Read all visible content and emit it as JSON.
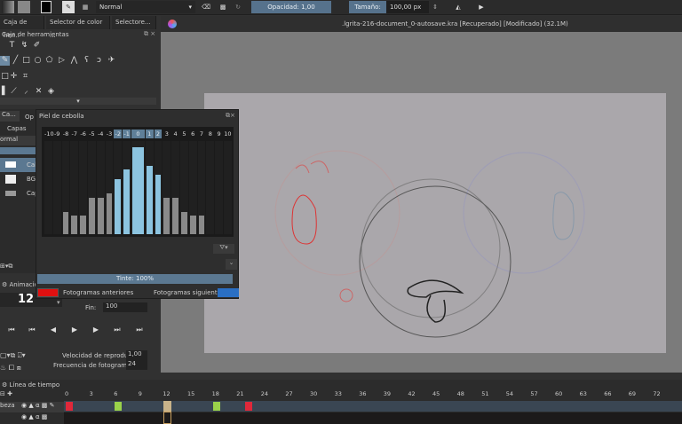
{
  "toolbar": {
    "blend_mode": "Normal",
    "opacity_label": "Opacidad:",
    "opacity_value": "1,00",
    "size_label": "Tamaño:",
    "size_value": "100,00 px"
  },
  "left_tabs": [
    "Caja de her...",
    "Selector de color ...",
    "Selectore..."
  ],
  "toolbox": {
    "title": "Caja de herramientas"
  },
  "document": {
    "title": ".lgrita-216-document_0-autosave.kra [Recuperado] [Modificado] (32.1M)"
  },
  "layers": {
    "tabs": [
      "Ca...",
      "Op"
    ],
    "title": "Capas",
    "blend": "ormal",
    "items": [
      "Cal",
      "BG",
      "Cap"
    ]
  },
  "onion_skin": {
    "title": "Piel de cebolla",
    "offsets": [
      "-10",
      "-9",
      "-8",
      "-7",
      "-6",
      "-5",
      "-4",
      "-3",
      "-2",
      "-1",
      "0",
      "1",
      "2",
      "3",
      "4",
      "5",
      "6",
      "7",
      "8",
      "9",
      "10"
    ],
    "opacity": [
      0,
      0,
      0.26,
      0.21,
      0.21,
      0.42,
      0.42,
      0.47,
      0.63,
      0.74,
      1.0,
      0.79,
      0.68,
      0.42,
      0.42,
      0.26,
      0.21,
      0.21,
      0,
      0,
      0
    ],
    "active": [
      false,
      false,
      false,
      false,
      false,
      false,
      false,
      false,
      true,
      true,
      true,
      true,
      true,
      false,
      false,
      false,
      false,
      false,
      false,
      false,
      false
    ],
    "tint_label": "Tinte: 100%",
    "tint_value": 1.0,
    "prev_frames_label": "Fotogramas anteriores",
    "next_frames_label": "Fotogramas siguientes",
    "prev_color": "#e01010",
    "next_color": "#2a6fc4"
  },
  "animation": {
    "title": "Animación",
    "current_frame": "12",
    "end_label": "Fin:",
    "end_value": "100",
    "speed_label": "Velocidad de reproducción:",
    "speed_value": "1,00",
    "fps_label": "Frecuencia de fotogramas",
    "fps_value": "24"
  },
  "timeline": {
    "title": "Línea de tiempo",
    "ticks": [
      "0",
      "3",
      "6",
      "9",
      "12",
      "15",
      "18",
      "21",
      "24",
      "27",
      "30",
      "33",
      "36",
      "39",
      "42",
      "45",
      "48",
      "51",
      "54",
      "57",
      "60",
      "63",
      "66",
      "69",
      "72"
    ],
    "layer_name": "beza",
    "current_frame": 12,
    "keyframes": [
      {
        "frame": 0,
        "color": "#e0283a"
      },
      {
        "frame": 6,
        "color": "#9ad24a"
      },
      {
        "frame": 18,
        "color": "#9ad24a"
      },
      {
        "frame": 22,
        "color": "#e0283a"
      }
    ]
  }
}
